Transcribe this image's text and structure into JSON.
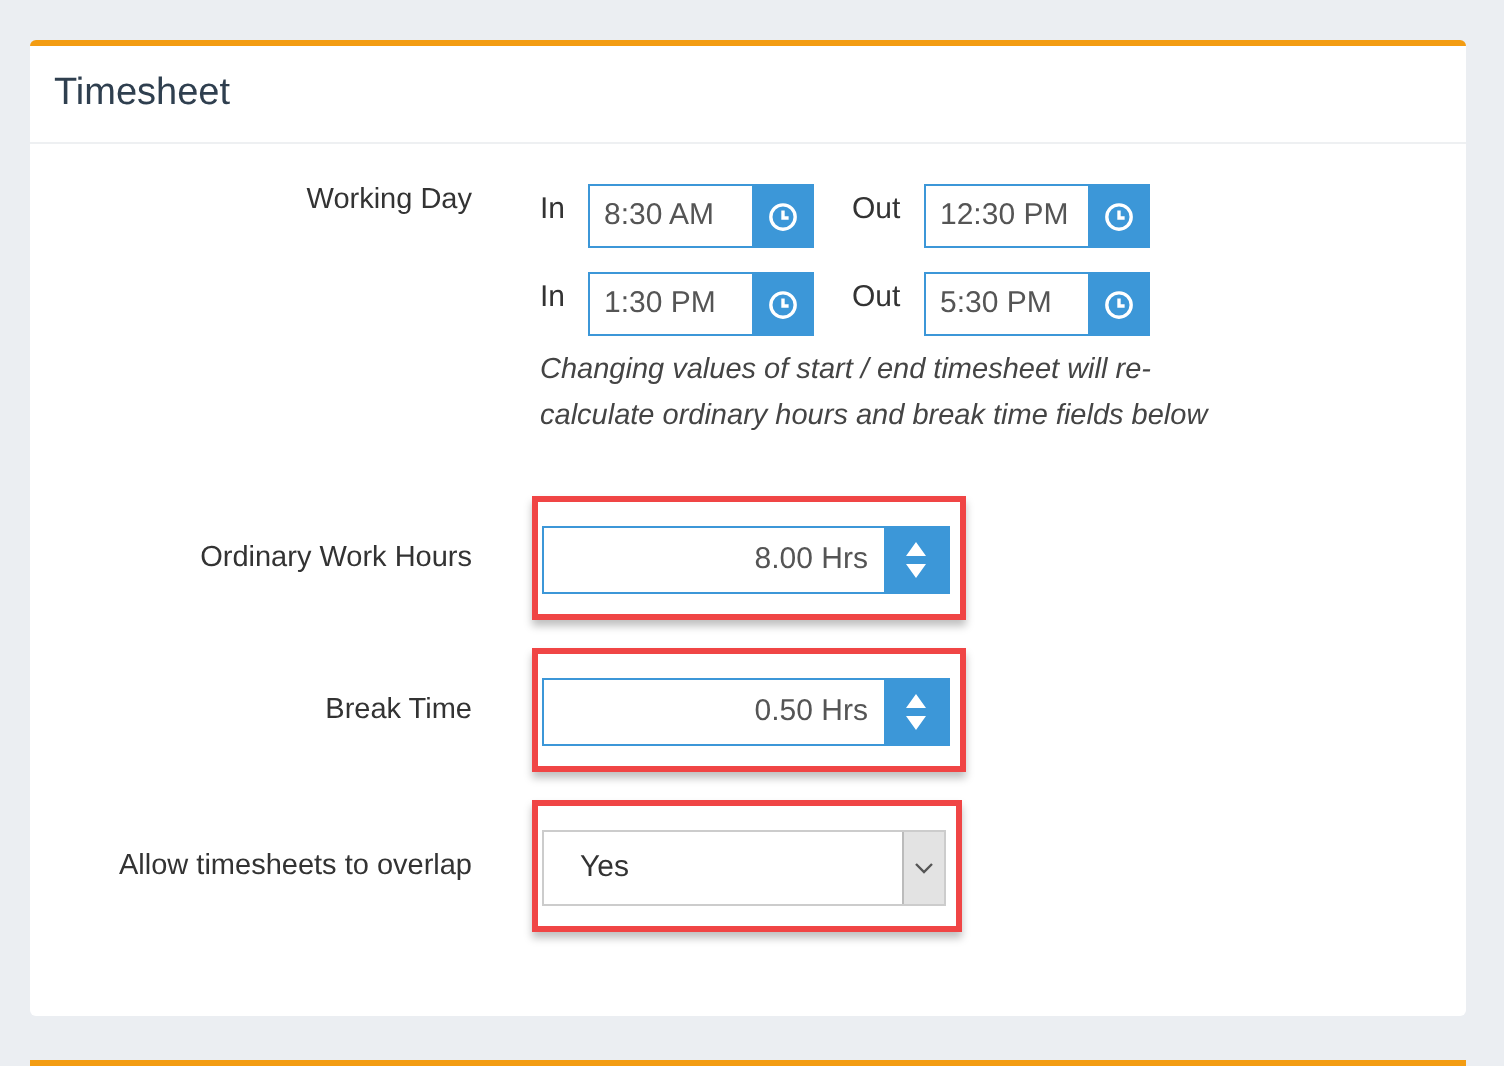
{
  "panel": {
    "title": "Timesheet"
  },
  "working_day": {
    "label": "Working Day",
    "shifts": [
      {
        "in_label": "In",
        "in_value": "8:30 AM",
        "out_label": "Out",
        "out_value": "12:30 PM"
      },
      {
        "in_label": "In",
        "in_value": "1:30 PM",
        "out_label": "Out",
        "out_value": "5:30 PM"
      }
    ],
    "note": "Changing values of start / end timesheet will re-calculate ordinary hours and break time fields below"
  },
  "fields": [
    {
      "kind": "spinner",
      "label": "Ordinary Work Hours",
      "value": "8.00 Hrs",
      "highlighted": true
    },
    {
      "kind": "spinner",
      "label": "Break Time",
      "value": "0.50 Hrs",
      "highlighted": true
    },
    {
      "kind": "select",
      "label": "Allow timesheets to overlap",
      "value": "Yes",
      "highlighted": true
    }
  ]
}
